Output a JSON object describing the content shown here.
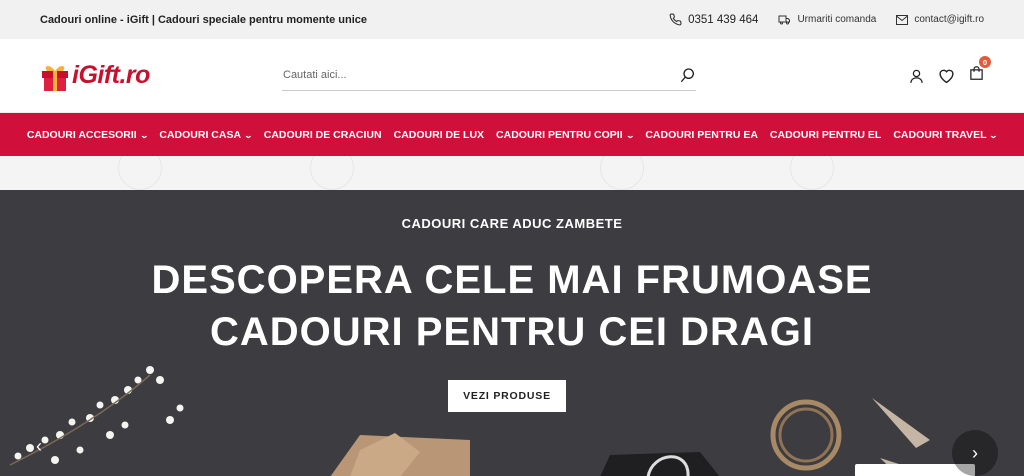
{
  "topbar": {
    "tagline": "Cadouri online - iGift | Cadouri speciale pentru momente unice",
    "phone": "0351 439 464",
    "track_order": "Urmariti comanda",
    "email": "contact@igift.ro"
  },
  "header": {
    "logo_text": "iGift.ro",
    "search_placeholder": "Cautati aici...",
    "cart_count": "0"
  },
  "nav": {
    "items": [
      {
        "label": "CADOURI ACCESORII",
        "dropdown": true
      },
      {
        "label": "CADOURI CASA",
        "dropdown": true
      },
      {
        "label": "CADOURI DE CRACIUN",
        "dropdown": false
      },
      {
        "label": "CADOURI DE LUX",
        "dropdown": false
      },
      {
        "label": "CADOURI PENTRU COPII",
        "dropdown": true
      },
      {
        "label": "CADOURI PENTRU EA",
        "dropdown": false
      },
      {
        "label": "CADOURI PENTRU EL",
        "dropdown": false
      },
      {
        "label": "CADOURI TRAVEL",
        "dropdown": true
      }
    ]
  },
  "hero": {
    "subtitle": "CADOURI CARE ADUC ZAMBETE",
    "title_line1": "DESCOPERA CELE MAI FRUMOASE",
    "title_line2": "CADOURI PENTRU CEI DRAGI",
    "button": "VEZI PRODUSE"
  },
  "colors": {
    "brand": "#d0103a",
    "hero_bg": "#3d3c40",
    "topbar_bg": "#f1f1f1"
  }
}
